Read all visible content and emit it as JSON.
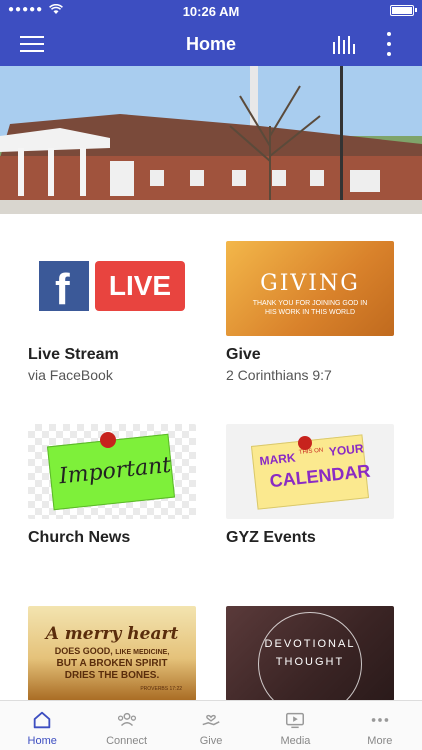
{
  "status_bar": {
    "time": "10:26 AM"
  },
  "header": {
    "title": "Home"
  },
  "tiles": [
    {
      "title": "Live Stream",
      "subtitle": "via FaceBook",
      "logo_letter": "f",
      "logo_word": "LIVE"
    },
    {
      "title": "Give",
      "subtitle": "2 Corinthians 9:7",
      "graphic_title": "GIVING",
      "graphic_sub": "THANK YOU FOR JOINING GOD IN HIS WORK IN THIS WORLD"
    },
    {
      "title": "Church News",
      "subtitle": "",
      "graphic_word": "Important"
    },
    {
      "title": "GYZ Events",
      "subtitle": "",
      "graphic_word1": "MARK",
      "graphic_word2": "THIS ON",
      "graphic_word3": "YOUR",
      "graphic_word4": "CALENDAR"
    },
    {
      "graphic_line1": "A merry heart",
      "graphic_line2": "DOES GOOD,",
      "graphic_line2b": "LIKE MEDICINE,",
      "graphic_line3": "BUT A BROKEN SPIRIT",
      "graphic_line4": "DRIES THE BONES.",
      "graphic_ref": "PROVERBS 17:22"
    },
    {
      "graphic_line1": "DEVOTIONAL",
      "graphic_line2": "THOUGHT"
    }
  ],
  "nav": [
    {
      "label": "Home",
      "icon": "home-icon",
      "active": true
    },
    {
      "label": "Connect",
      "icon": "people-icon",
      "active": false
    },
    {
      "label": "Give",
      "icon": "give-icon",
      "active": false
    },
    {
      "label": "Media",
      "icon": "media-icon",
      "active": false
    },
    {
      "label": "More",
      "icon": "more-icon",
      "active": false
    }
  ],
  "colors": {
    "primary": "#3d4ec1",
    "facebook": "#3b5998",
    "live_red": "#e8443f"
  }
}
